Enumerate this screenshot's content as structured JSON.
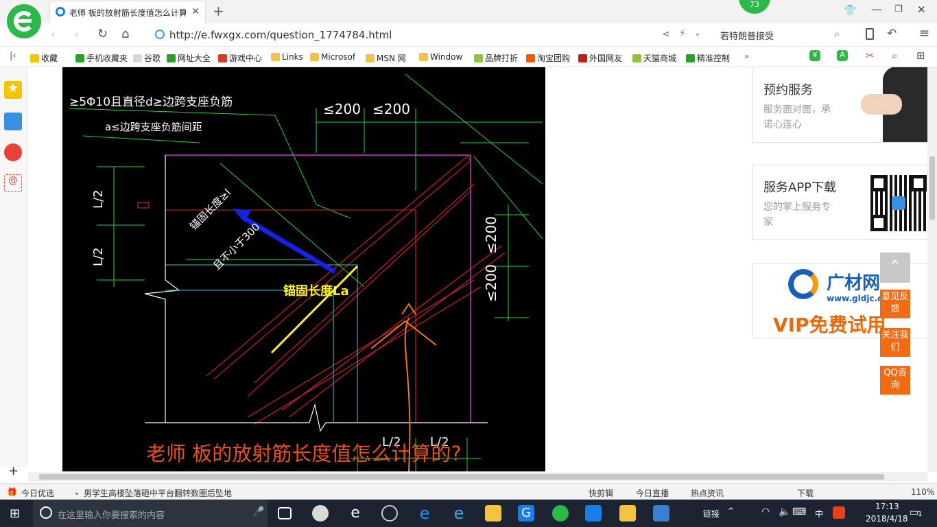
{
  "browser": {
    "tab_title": "老师 板的放射筋长度值怎么计算",
    "badge_count": "73",
    "url": "http://e.fwxgx.com/question_1774784.html",
    "search_text": "若特朗普接受"
  },
  "bookmarks": [
    {
      "label": "收藏",
      "color": "#f5c400"
    },
    {
      "label": "手机收藏夹",
      "color": "#2aa22a"
    },
    {
      "label": "谷歌",
      "color": "#d8d8d8"
    },
    {
      "label": "网址大全",
      "color": "#2a9d2a"
    },
    {
      "label": "游戏中心",
      "color": "#d83a2a"
    },
    {
      "label": "Links",
      "color": "#f1c24b"
    },
    {
      "label": "Microsof",
      "color": "#f1c24b"
    },
    {
      "label": "MSN 网",
      "color": "#f1c24b"
    },
    {
      "label": "Window",
      "color": "#f1c24b"
    },
    {
      "label": "品牌打折",
      "color": "#8cc63f"
    },
    {
      "label": "淘宝团购",
      "color": "#f05a00"
    },
    {
      "label": "外国网友",
      "color": "#c41a1a"
    },
    {
      "label": "天猫商城",
      "color": "#8cc63f"
    },
    {
      "label": "精准控制",
      "color": "#2aa22a"
    }
  ],
  "sidebar_icons": [
    "star-icon",
    "list-icon",
    "weibo-icon",
    "email-icon"
  ],
  "cad": {
    "text_top1": "≥5Φ10且直径d≥边跨支座负筋",
    "text_top2": "a≤边跨支座负筋间距",
    "dim_200_a": "≤200",
    "dim_200_b": "≤200",
    "dim_200_c": "≤200",
    "dim_200_d": "≤200",
    "left_l2_a": "L/2",
    "left_l2_b": "L/2",
    "anchor_small": "锚固长度≥l",
    "not_less": "且不小于300",
    "anchor_label": "锚固长度La",
    "bottom_l2_a": "L/2",
    "bottom_l2_b": "L/2",
    "question": "老师  板的放射筋长度值怎么计算的?"
  },
  "right_panel": {
    "service_title": "预约服务",
    "service_sub": "服务面对面，承诺心连心",
    "app_title": "服务APP下载",
    "app_sub": "您的掌上服务专家",
    "ad_brand": "广材网",
    "ad_url": "www.gldjc.com",
    "ad_vip": "VIP免费试用",
    "feedback": "意见反馈",
    "follow": "关注我们",
    "qq": "QQ咨询"
  },
  "statusbar": {
    "today": "今日优选",
    "news": "男学生高楼坠落砸中平台翻转数圈后坠地",
    "quickcut": "快剪辑",
    "live": "今日直播",
    "hotnews": "热点资讯",
    "download": "下载",
    "zoom": "110%"
  },
  "taskbar": {
    "search_placeholder": "在这里输入你要搜索的内容",
    "link": "链接",
    "ime": "中",
    "time": "17:13",
    "date": "2018/4/18",
    "notif": "1"
  },
  "colors": {
    "accent_green": "#2db84a",
    "orange": "#f26b14",
    "cad_bg": "#000000"
  }
}
